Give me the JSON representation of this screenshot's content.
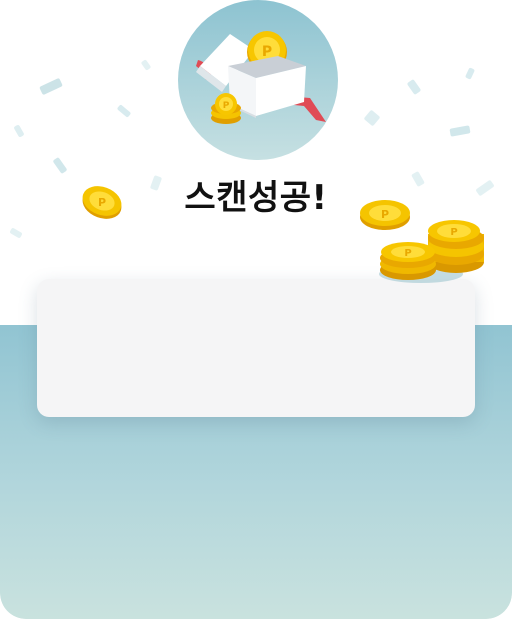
{
  "header": {
    "title": "스캔성공!"
  },
  "colors": {
    "teal_bg": "#91c4d2",
    "coin_gold": "#f5c400",
    "ribbon_red": "#e04b55"
  },
  "icons": {
    "hero": "gift-box-with-coins-icon",
    "coin": "point-coin-icon"
  }
}
